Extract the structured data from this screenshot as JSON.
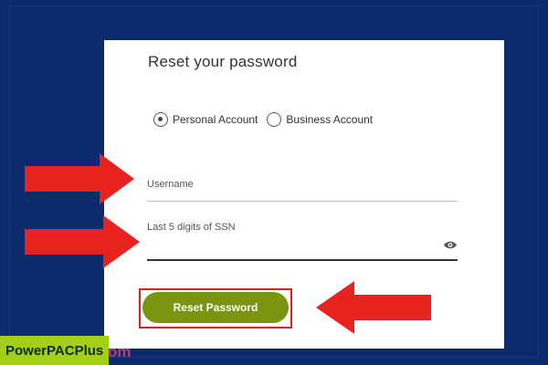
{
  "form": {
    "title": "Reset your password",
    "account_types": [
      {
        "label": "Personal Account",
        "selected": true
      },
      {
        "label": "Business Account",
        "selected": false
      }
    ],
    "fields": {
      "username_label": "Username",
      "ssn_label": "Last 5 digits of SSN"
    },
    "submit_label": "Reset Password"
  },
  "icons": {
    "password_toggle": "eye-icon",
    "annotations": "red-arrow-icon"
  },
  "brand": {
    "name": "PowerPACPlus",
    "suffix": "om"
  },
  "colors": {
    "background": "#0c2a6b",
    "button": "#7a9410",
    "annotation": "#e02020",
    "brand_badge": "#a3d016"
  }
}
